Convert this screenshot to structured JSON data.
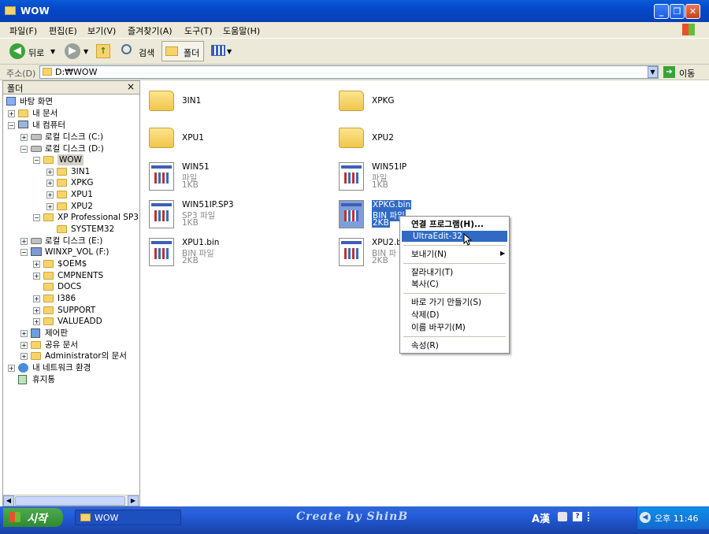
{
  "window": {
    "title": "WOW"
  },
  "menu": [
    "파일(F)",
    "편집(E)",
    "보기(V)",
    "즐겨찾기(A)",
    "도구(T)",
    "도움말(H)"
  ],
  "toolbar": {
    "back": "뒤로",
    "search": "검색",
    "folders": "폴더"
  },
  "address": {
    "label": "주소(D)",
    "value": "D:₩WOW",
    "go": "이동"
  },
  "folder_pane": {
    "header": "폴더",
    "close": "×",
    "tree": [
      {
        "label": "바탕 화면"
      },
      {
        "label": "내 문서"
      },
      {
        "label": "내 컴퓨터"
      },
      {
        "label": "로컬 디스크 (C:)"
      },
      {
        "label": "로컬 디스크 (D:)"
      },
      {
        "label": "WOW"
      },
      {
        "label": "3IN1"
      },
      {
        "label": "XPKG"
      },
      {
        "label": "XPU1"
      },
      {
        "label": "XPU2"
      },
      {
        "label": "XP Professional SP3"
      },
      {
        "label": "SYSTEM32"
      },
      {
        "label": "로컬 디스크 (E:)"
      },
      {
        "label": "WINXP_VOL (F:)"
      },
      {
        "label": "$OEM$"
      },
      {
        "label": "CMPNENTS"
      },
      {
        "label": "DOCS"
      },
      {
        "label": "I386"
      },
      {
        "label": "SUPPORT"
      },
      {
        "label": "VALUEADD"
      },
      {
        "label": "제어판"
      },
      {
        "label": "공유 문서"
      },
      {
        "label": "Administrator의 문서"
      },
      {
        "label": "내 네트워크 환경"
      },
      {
        "label": "휴지통"
      }
    ]
  },
  "items": [
    {
      "name": "3IN1"
    },
    {
      "name": "XPKG"
    },
    {
      "name": "XPU1"
    },
    {
      "name": "XPU2"
    },
    {
      "name": "WIN51",
      "type": "파일",
      "size": "1KB"
    },
    {
      "name": "WIN51IP",
      "type": "파일",
      "size": "1KB"
    },
    {
      "name": "WIN51IP.SP3",
      "type": "SP3 파일",
      "size": "1KB"
    },
    {
      "name": "XPKG.bin",
      "type": "BIN 파일",
      "size": "2KB"
    },
    {
      "name": "XPU1.bin",
      "type": "BIN 파일",
      "size": "2KB"
    },
    {
      "name": "XPU2.b",
      "type": "BIN 파",
      "size": "2KB"
    }
  ],
  "context_menu": [
    {
      "label": "연결 프로그램(H)..."
    },
    {
      "label": "UltraEdit-32"
    },
    {
      "label": "보내기(N)"
    },
    {
      "label": "잘라내기(T)"
    },
    {
      "label": "복사(C)"
    },
    {
      "label": "바로 가기 만들기(S)"
    },
    {
      "label": "삭제(D)"
    },
    {
      "label": "이름 바꾸기(M)"
    },
    {
      "label": "속성(R)"
    }
  ],
  "taskbar": {
    "start": "시작",
    "window": "WOW",
    "banner": "Create by ShinB",
    "ime": "A漢",
    "clock": "오후 11:46"
  },
  "colors": {
    "accent": "#316ac5",
    "selection": "#316ac5",
    "title_bar": "#0a5bd8"
  }
}
